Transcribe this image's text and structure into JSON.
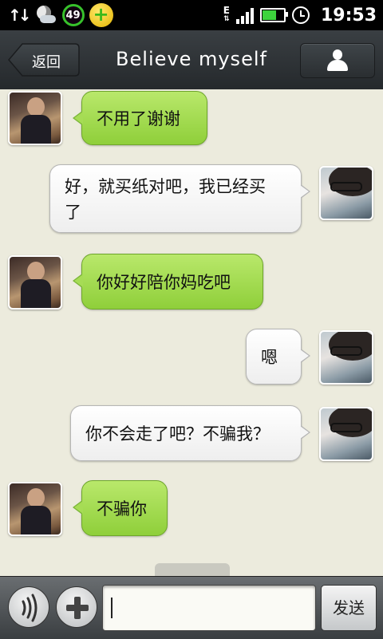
{
  "status_bar": {
    "battery_level_badge": "49",
    "network_type": "E",
    "time": "19:53",
    "battery_fill": 0.7,
    "signal_bars": 4
  },
  "header": {
    "back_label": "返回",
    "title": "Believe myself",
    "profile_icon": "person-icon"
  },
  "messages": [
    {
      "from": "friend",
      "text": "不用了谢谢"
    },
    {
      "from": "me",
      "line1": "好，就买纸对吧，我已经买",
      "line2": "了"
    },
    {
      "from": "friend",
      "text": "你好好陪你妈吃吧"
    },
    {
      "from": "me",
      "text": "嗯"
    },
    {
      "from": "me",
      "text": "你不会走了吧？不骗我？"
    },
    {
      "from": "friend",
      "text": "不骗你"
    }
  ],
  "composer": {
    "voice_icon": "voice-icon",
    "plus_icon": "plus-icon",
    "input_value": "",
    "send_label": "发送"
  },
  "colors": {
    "incoming_bubble": "#a6dc55",
    "outgoing_bubble": "#f5f5f5",
    "chat_background": "#ecebdd",
    "header_background": "#2f3437"
  }
}
